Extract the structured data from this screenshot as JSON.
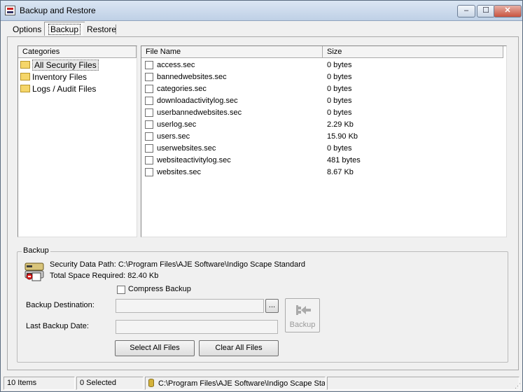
{
  "window": {
    "title": "Backup and Restore",
    "minimize": "‒",
    "maximize": "☐",
    "close": "✕"
  },
  "tabs": [
    {
      "label": "Options"
    },
    {
      "label": "Backup"
    },
    {
      "label": "Restore"
    }
  ],
  "categories": {
    "header": "Categories",
    "items": [
      {
        "label": "All Security Files",
        "selected": true
      },
      {
        "label": "Inventory Files"
      },
      {
        "label": "Logs / Audit Files"
      }
    ]
  },
  "files": {
    "columns": {
      "name": "File Name",
      "size": "Size"
    },
    "rows": [
      {
        "name": "access.sec",
        "size": "0 bytes"
      },
      {
        "name": "bannedwebsites.sec",
        "size": "0 bytes"
      },
      {
        "name": "categories.sec",
        "size": "0 bytes"
      },
      {
        "name": "downloadactivitylog.sec",
        "size": "0 bytes"
      },
      {
        "name": "userbannedwebsites.sec",
        "size": "0 bytes"
      },
      {
        "name": "userlog.sec",
        "size": "2.29 Kb"
      },
      {
        "name": "users.sec",
        "size": "15.90 Kb"
      },
      {
        "name": "userwebsites.sec",
        "size": "0 bytes"
      },
      {
        "name": "websiteactivitylog.sec",
        "size": "481 bytes"
      },
      {
        "name": "websites.sec",
        "size": "8.67 Kb"
      }
    ]
  },
  "backup": {
    "group_label": "Backup",
    "data_path": "Security Data Path: C:\\Program Files\\AJE Software\\Indigo Scape Standard",
    "space_required": "Total Space Required: 82.40 Kb",
    "compress_label": "Compress Backup",
    "destination_label": "Backup Destination:",
    "destination_value": "",
    "browse_label": "...",
    "last_backup_label": "Last Backup Date:",
    "last_backup_value": "",
    "backup_button": "Backup",
    "select_all": "Select All Files",
    "clear_all": "Clear All Files"
  },
  "status": {
    "items": "10 Items",
    "selected": "0 Selected",
    "path": "C:\\Program Files\\AJE Software\\Indigo Scape Star"
  }
}
